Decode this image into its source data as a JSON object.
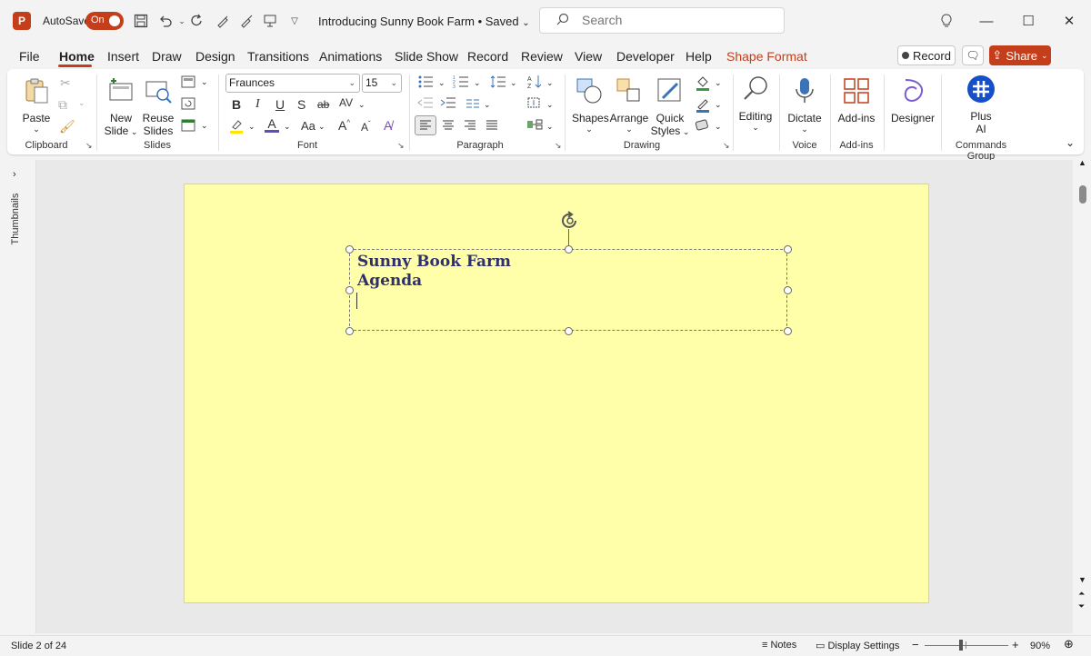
{
  "titlebar": {
    "autosave_label": "AutoSave",
    "autosave_state": "On",
    "doc_title": "Introducing Sunny Book Farm • Saved",
    "search_placeholder": "Search"
  },
  "tabs": [
    "File",
    "Home",
    "Insert",
    "Draw",
    "Design",
    "Transitions",
    "Animations",
    "Slide Show",
    "Record",
    "Review",
    "View",
    "Developer",
    "Help",
    "Shape Format"
  ],
  "active_tab": "Home",
  "actions": {
    "record_label": "Record",
    "share_label": "Share"
  },
  "ribbon": {
    "clipboard": {
      "label": "Clipboard",
      "paste": "Paste"
    },
    "slides": {
      "label": "Slides",
      "new_slide_1": "New",
      "new_slide_2": "Slide",
      "reuse_1": "Reuse",
      "reuse_2": "Slides"
    },
    "font": {
      "label": "Font",
      "font_name": "Fraunces",
      "font_size": "15"
    },
    "paragraph": {
      "label": "Paragraph"
    },
    "drawing": {
      "label": "Drawing",
      "shapes": "Shapes",
      "arrange": "Arrange",
      "quick_1": "Quick",
      "quick_2": "Styles"
    },
    "editing": {
      "label": "Editing"
    },
    "voice": {
      "label": "Voice",
      "dictate": "Dictate"
    },
    "addins": {
      "label": "Add-ins",
      "addins_btn": "Add-ins"
    },
    "designer": {
      "label": "Designer"
    },
    "commands": {
      "label": "Commands Group",
      "plus_1": "Plus",
      "plus_2": "AI"
    }
  },
  "left_pane": {
    "label": "Thumbnails"
  },
  "slide": {
    "title_line1": "Sunny Book Farm",
    "title_line2": "Agenda",
    "background": "#ffffa9"
  },
  "status": {
    "slide_info": "Slide 2 of 24",
    "notes": "Notes",
    "display_settings": "Display Settings",
    "zoom": "90%"
  },
  "colors": {
    "accent": "#c43e1c",
    "text_dark": "#2f2f6f"
  }
}
